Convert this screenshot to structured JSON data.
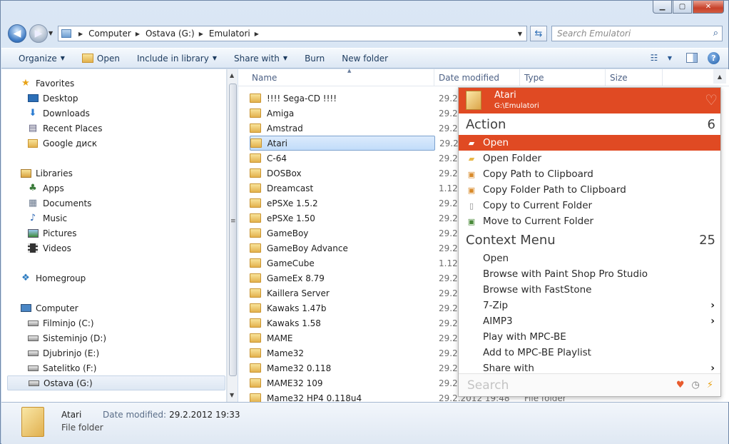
{
  "address": {
    "segments": [
      "Computer",
      "Ostava (G:)",
      "Emulatori"
    ]
  },
  "search": {
    "placeholder": "Search Emulatori"
  },
  "toolbar": {
    "organize": "Organize",
    "open": "Open",
    "include": "Include in library",
    "share": "Share with",
    "burn": "Burn",
    "new_folder": "New folder"
  },
  "nav": {
    "favorites": "Favorites",
    "desktop": "Desktop",
    "downloads": "Downloads",
    "recent": "Recent Places",
    "google": "Google диск",
    "libraries": "Libraries",
    "apps": "Apps",
    "documents": "Documents",
    "music": "Music",
    "pictures": "Pictures",
    "videos": "Videos",
    "homegroup": "Homegroup",
    "computer": "Computer",
    "drive_c": "Filminjo (C:)",
    "drive_d": "Sisteminjo (D:)",
    "drive_e": "Djubrinjo (E:)",
    "drive_f": "Satelitko (F:)",
    "drive_g": "Ostava (G:)"
  },
  "columns": {
    "name": "Name",
    "date": "Date modified",
    "type": "Type",
    "size": "Size"
  },
  "files": [
    {
      "name": "!!!! Sega-CD !!!!",
      "date": "29.2."
    },
    {
      "name": "Amiga",
      "date": "29.2."
    },
    {
      "name": "Amstrad",
      "date": "29.2."
    },
    {
      "name": "Atari",
      "date": "29.2."
    },
    {
      "name": "C-64",
      "date": "29.2."
    },
    {
      "name": "DOSBox",
      "date": "29.2."
    },
    {
      "name": "Dreamcast",
      "date": "1.12."
    },
    {
      "name": "ePSXe 1.5.2",
      "date": "29.2."
    },
    {
      "name": "ePSXe 1.50",
      "date": "29.2."
    },
    {
      "name": "GameBoy",
      "date": "29.2."
    },
    {
      "name": "GameBoy Advance",
      "date": "29.2."
    },
    {
      "name": "GameCube",
      "date": "1.12."
    },
    {
      "name": "GameEx 8.79",
      "date": "29.2."
    },
    {
      "name": "Kaillera Server",
      "date": "29.2."
    },
    {
      "name": "Kawaks 1.47b",
      "date": "29.2."
    },
    {
      "name": "Kawaks 1.58",
      "date": "29.2."
    },
    {
      "name": "MAME",
      "date": "29.2."
    },
    {
      "name": "Mame32",
      "date": "29.2."
    },
    {
      "name": "Mame32 0.118",
      "date": "29.2."
    },
    {
      "name": "MAME32 109",
      "date": "29.2."
    },
    {
      "name": "Mame32 HP4 0.118u4",
      "date": "29.2.2012 19:48",
      "type": "File folder"
    }
  ],
  "details": {
    "name": "Atari",
    "modified_label": "Date modified:",
    "modified_value": "29.2.2012 19:33",
    "type": "File folder"
  },
  "launcher": {
    "title": "Atari",
    "path": "G:\\Emulatori",
    "action_label": "Action",
    "action_count": "6",
    "actions": [
      "Open",
      "Open Folder",
      "Copy Path to Clipboard",
      "Copy Folder Path to Clipboard",
      "Copy to Current Folder",
      "Move to Current Folder"
    ],
    "context_label": "Context Menu",
    "context_count": "25",
    "context": [
      "Open",
      "Browse with Paint Shop Pro Studio",
      "Browse with FastStone",
      "7-Zip",
      "AIMP3",
      "Play with MPC-BE",
      "Add to MPC-BE Playlist",
      "Share with"
    ],
    "search_placeholder": "Search"
  }
}
